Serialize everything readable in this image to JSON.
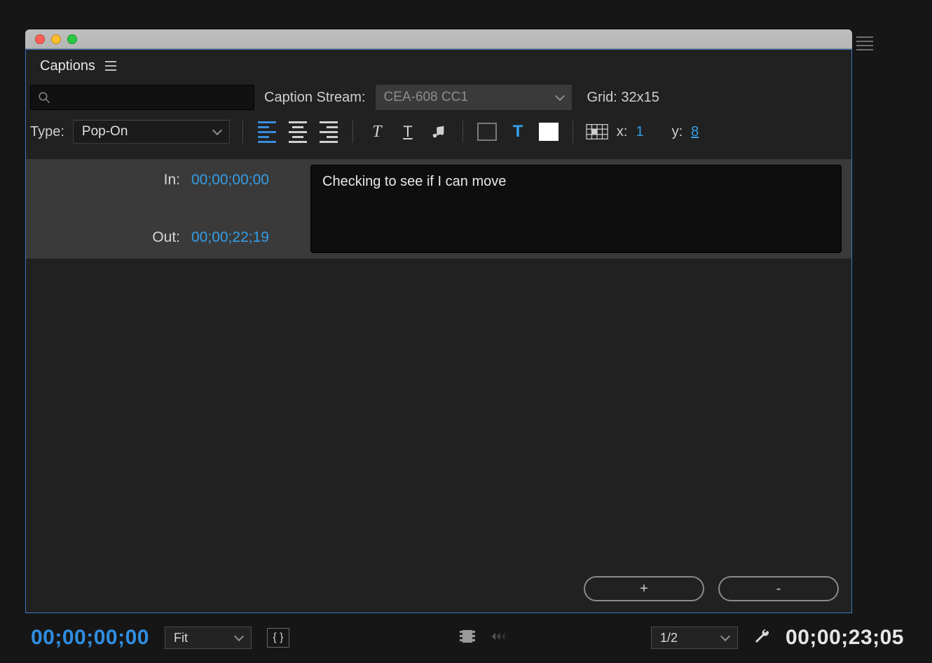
{
  "panel": {
    "title": "Captions"
  },
  "row1": {
    "caption_stream_label": "Caption Stream:",
    "caption_stream_value": "CEA-608 CC1",
    "grid_label": "Grid: 32x15",
    "search_value": ""
  },
  "toolbar": {
    "type_label": "Type:",
    "type_value": "Pop-On",
    "x_label": "x:",
    "x_value": "1",
    "y_label": "y:",
    "y_value": "8"
  },
  "caption_row": {
    "in_label": "In:",
    "in_value": "00;00;00;00",
    "out_label": "Out:",
    "out_value": "00;00;22;19",
    "text": "Checking to see if I can move"
  },
  "buttons": {
    "add": "+",
    "remove": "-"
  },
  "status": {
    "playhead": "00;00;00;00",
    "zoom": "Fit",
    "resolution": "1/2",
    "duration": "00;00;23;05"
  }
}
